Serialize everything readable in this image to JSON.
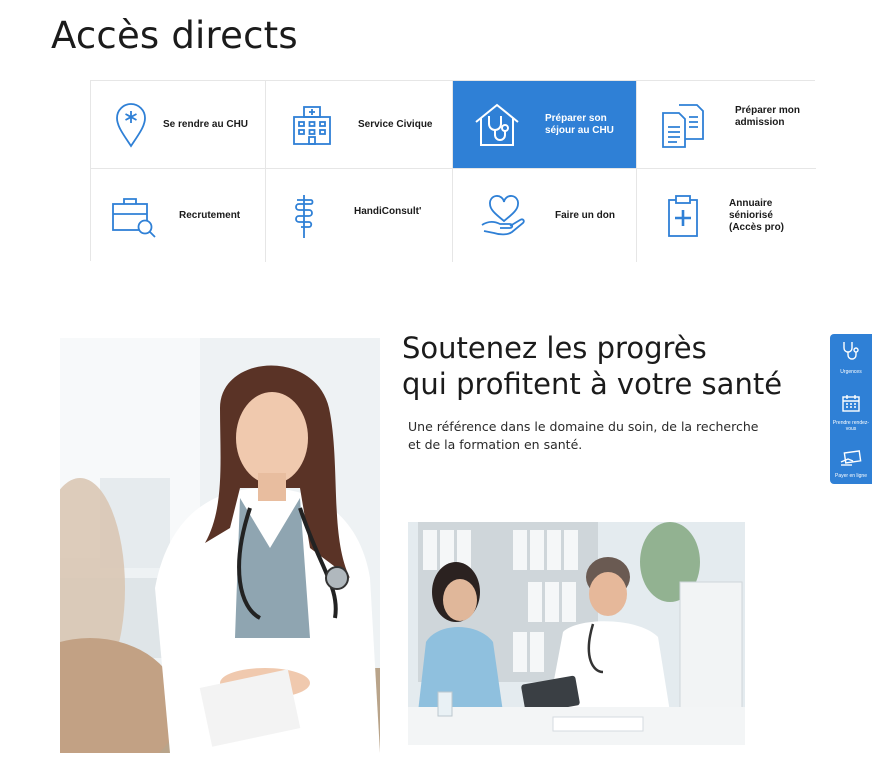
{
  "section": {
    "title": "Accès directs"
  },
  "tiles": [
    {
      "label": "Se rendre au CHU",
      "icon": "location-pin-icon"
    },
    {
      "label": "Service Civique",
      "icon": "hospital-building-icon"
    },
    {
      "label": "Préparer son séjour au CHU",
      "icon": "home-stethoscope-icon"
    },
    {
      "label": "Préparer mon admission",
      "icon": "documents-icon"
    },
    {
      "label": "Recrutement",
      "icon": "briefcase-search-icon"
    },
    {
      "label": "HandiConsult'",
      "icon": "caduceus-icon"
    },
    {
      "label": "Faire un don",
      "icon": "hand-heart-icon"
    },
    {
      "label": "Annuaire séniorisé (Accès pro)",
      "icon": "clipboard-plus-icon"
    }
  ],
  "promo": {
    "headline_line1": "Soutenez les progrès",
    "headline_line2": "qui profitent à votre santé",
    "subtext": "Une référence dans le domaine du soin, de la recherche et de la formation en santé."
  },
  "sidebar": {
    "items": [
      {
        "label": "Urgences",
        "icon": "stethoscope-icon"
      },
      {
        "label": "Prendre rendez-vous",
        "icon": "calendar-icon"
      },
      {
        "label": "Payer en ligne",
        "icon": "payment-card-icon"
      }
    ]
  },
  "colors": {
    "accent": "#2f80d6",
    "border": "#e6e6e6",
    "text": "#1b1b1b"
  }
}
